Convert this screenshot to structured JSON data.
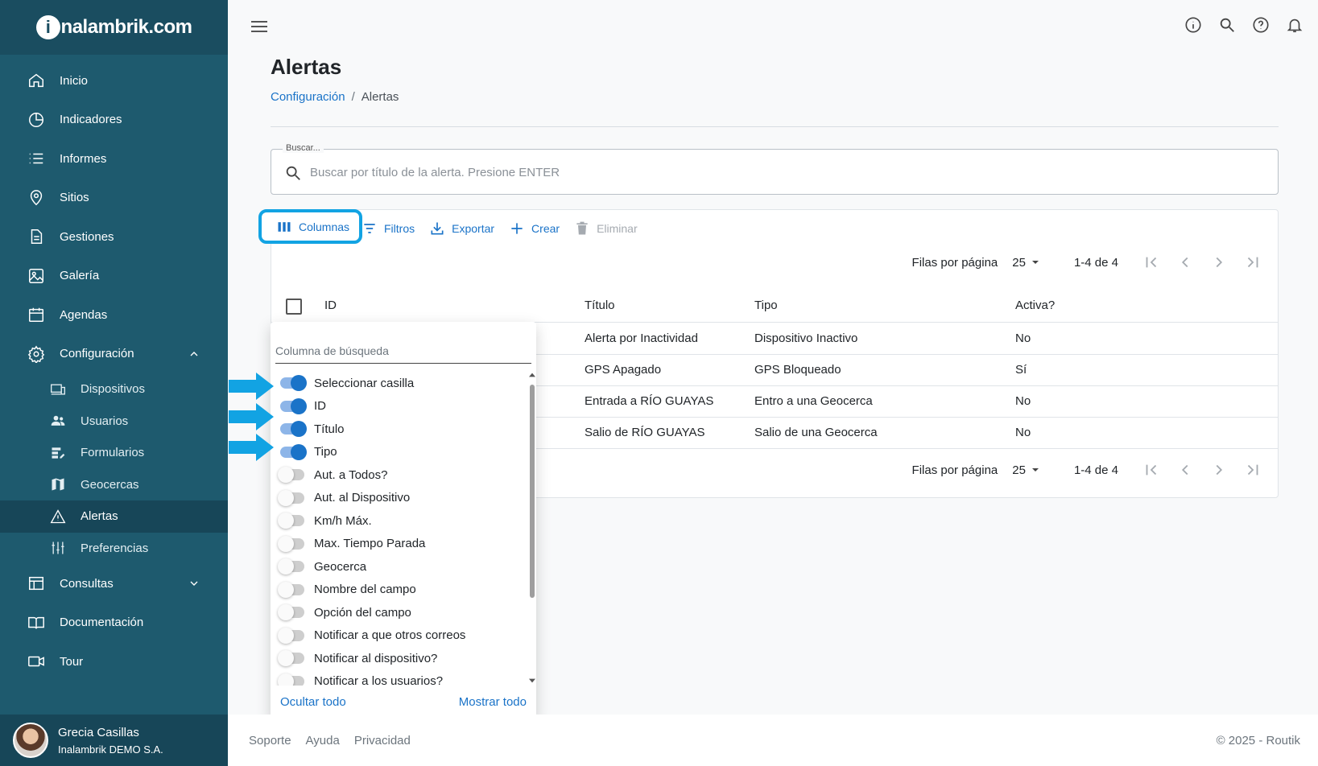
{
  "brand": {
    "logo_text_i": "i",
    "logo_text_rest": "nalambrik.com"
  },
  "sidebar": {
    "items": [
      {
        "label": "Inicio"
      },
      {
        "label": "Indicadores"
      },
      {
        "label": "Informes"
      },
      {
        "label": "Sitios"
      },
      {
        "label": "Gestiones"
      },
      {
        "label": "Galería"
      },
      {
        "label": "Agendas"
      },
      {
        "label": "Configuración"
      }
    ],
    "sub_items": [
      {
        "label": "Dispositivos"
      },
      {
        "label": "Usuarios"
      },
      {
        "label": "Formularios"
      },
      {
        "label": "Geocercas"
      },
      {
        "label": "Alertas"
      },
      {
        "label": "Preferencias"
      }
    ],
    "bottom_items": [
      {
        "label": "Consultas"
      },
      {
        "label": "Documentación"
      },
      {
        "label": "Tour"
      }
    ],
    "user": {
      "name": "Grecia Casillas",
      "org": "Inalambrik DEMO S.A."
    }
  },
  "header": {
    "title": "Alertas",
    "breadcrumb": {
      "parent": "Configuración",
      "separator": "/",
      "current": "Alertas"
    }
  },
  "search": {
    "label": "Buscar...",
    "placeholder": "Buscar por título de la alerta. Presione ENTER"
  },
  "toolbar": {
    "columns": "Columnas",
    "filters": "Filtros",
    "export": "Exportar",
    "create": "Crear",
    "delete": "Eliminar"
  },
  "pagination": {
    "rows_per_page_label": "Filas por página",
    "rows_per_page": "25",
    "range": "1-4 de 4"
  },
  "table": {
    "headers": {
      "id": "ID",
      "title": "Título",
      "type": "Tipo",
      "active": "Activa?"
    },
    "rows": [
      {
        "title": "Alerta por Inactividad",
        "type": "Dispositivo Inactivo",
        "active": "No"
      },
      {
        "title": "GPS Apagado",
        "type": "GPS Bloqueado",
        "active": "Sí"
      },
      {
        "title": "Entrada a RÍO GUAYAS",
        "type": "Entro a una Geocerca",
        "active": "No"
      },
      {
        "title": "Salio de RÍO GUAYAS",
        "type": "Salio de una Geocerca",
        "active": "No"
      }
    ]
  },
  "columns_popup": {
    "search_placeholder": "Columna de búsqueda",
    "items": [
      {
        "label": "Seleccionar casilla",
        "on": true
      },
      {
        "label": "ID",
        "on": true
      },
      {
        "label": "Título",
        "on": true
      },
      {
        "label": "Tipo",
        "on": true
      },
      {
        "label": "Aut. a Todos?",
        "on": false
      },
      {
        "label": "Aut. al Dispositivo",
        "on": false
      },
      {
        "label": "Km/h Máx.",
        "on": false
      },
      {
        "label": "Max. Tiempo Parada",
        "on": false
      },
      {
        "label": "Geocerca",
        "on": false
      },
      {
        "label": "Nombre del campo",
        "on": false
      },
      {
        "label": "Opción del campo",
        "on": false
      },
      {
        "label": "Notificar a que otros correos",
        "on": false
      },
      {
        "label": "Notificar al dispositivo?",
        "on": false
      },
      {
        "label": "Notificar a los usuarios?",
        "on": false
      }
    ],
    "hide_all": "Ocultar todo",
    "show_all": "Mostrar todo"
  },
  "footer": {
    "links": [
      "Soporte",
      "Ayuda",
      "Privacidad"
    ],
    "copyright": "© 2025 - Routik"
  },
  "colors": {
    "sidebar": "#1e5a6e",
    "accent": "#1a73c8",
    "highlight": "#12a3e3"
  }
}
